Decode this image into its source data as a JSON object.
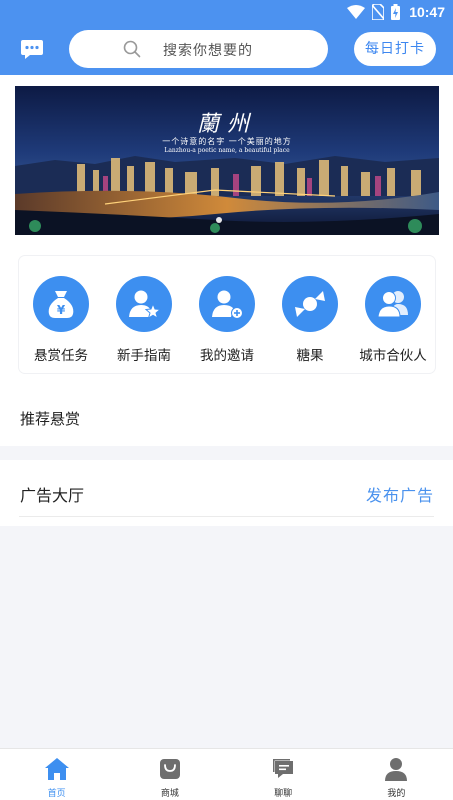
{
  "status_bar": {
    "time": "10:47"
  },
  "header": {
    "search_placeholder": "搜索你想要的",
    "checkin_label": "每日打卡"
  },
  "banner": {
    "title": "蘭州",
    "subtitle": "一个诗意的名字 一个美丽的地方",
    "subtitle_en": "Lanzhou-a poetic name, a beautiful place"
  },
  "menu": {
    "items": [
      {
        "label": "悬赏任务",
        "icon": "money-bag-icon"
      },
      {
        "label": "新手指南",
        "icon": "user-star-icon"
      },
      {
        "label": "我的邀请",
        "icon": "user-add-icon"
      },
      {
        "label": "糖果",
        "icon": "candy-icon"
      },
      {
        "label": "城市合伙人",
        "icon": "users-icon"
      }
    ]
  },
  "recommend": {
    "title": "推荐悬赏"
  },
  "ads": {
    "title": "广告大厅",
    "publish_label": "发布广告"
  },
  "tabs": [
    {
      "label": "首页",
      "icon": "home-icon",
      "active": true
    },
    {
      "label": "商城",
      "icon": "shop-bag-icon",
      "active": false
    },
    {
      "label": "聊聊",
      "icon": "chat-bubble-icon",
      "active": false
    },
    {
      "label": "我的",
      "icon": "person-icon",
      "active": false
    }
  ],
  "colors": {
    "primary": "#4c92f0",
    "icon_blue": "#3d8ff0",
    "background": "#f4f5f9"
  }
}
